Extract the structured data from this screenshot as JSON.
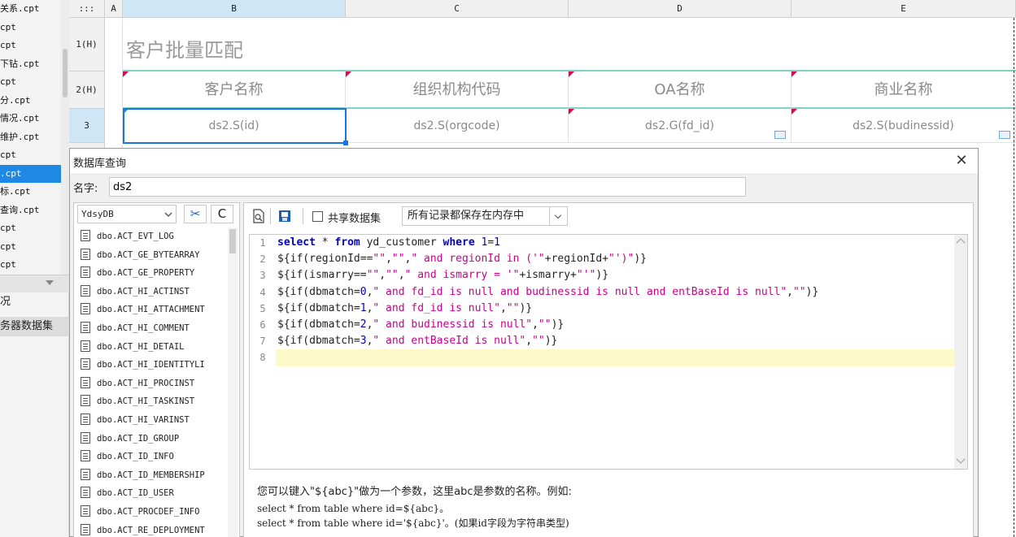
{
  "left_panel": {
    "files": [
      "关系.cpt",
      "cpt",
      "cpt",
      "下钻.cpt",
      "cpt",
      "分.cpt",
      "情况.cpt",
      "维护.cpt",
      "cpt",
      ".cpt",
      "标.cpt",
      "查询.cpt",
      "cpt",
      "cpt",
      "cpt"
    ],
    "selected_index": 9,
    "tree_items": [
      "况",
      "务器数据集"
    ]
  },
  "sheet": {
    "corner_label": ":::",
    "columns": [
      "A",
      "B",
      "C",
      "D",
      "E"
    ],
    "rows": [
      "1(H)",
      "2(H)",
      "3"
    ],
    "title": "客户批量匹配",
    "headers": [
      "客户名称",
      "组织机构代码",
      "OA名称",
      "商业名称"
    ],
    "cells": [
      "ds2.S(id)",
      "ds2.S(orgcode)",
      "ds2.G(fd_id)",
      "ds2.S(budinessid)"
    ]
  },
  "dialog": {
    "title": "数据库查询",
    "close": "✕",
    "name_label": "名字:",
    "name_value": "ds2",
    "database": "YdsyDB",
    "refresh_glyph": "C",
    "tools_glyph": "✂",
    "tables": [
      "dbo.ACT_EVT_LOG",
      "dbo.ACT_GE_BYTEARRAY",
      "dbo.ACT_GE_PROPERTY",
      "dbo.ACT_HI_ACTINST",
      "dbo.ACT_HI_ATTACHMENT",
      "dbo.ACT_HI_COMMENT",
      "dbo.ACT_HI_DETAIL",
      "dbo.ACT_HI_IDENTITYLI",
      "dbo.ACT_HI_PROCINST",
      "dbo.ACT_HI_TASKINST",
      "dbo.ACT_HI_VARINST",
      "dbo.ACT_ID_GROUP",
      "dbo.ACT_ID_INFO",
      "dbo.ACT_ID_MEMBERSHIP",
      "dbo.ACT_ID_USER",
      "dbo.ACT_PROCDEF_INFO",
      "dbo.ACT_RE_DEPLOYMENT"
    ],
    "share_label": "共享数据集",
    "share_checked": false,
    "cache_option": "所有记录都保存在内存中",
    "sql_lines": [
      "select * from yd_customer where 1=1",
      "${if(regionId==\"\",\"\",\" and regionId in ('\"+regionId+\"')\")}",
      "${if(ismarry==\"\",\"\",\" and ismarry = '\"+ismarry+\"'\")}",
      "${if(dbmatch=0,\" and fd_id is null and budinessid is null and entBaseId is null\",\"\")}",
      "${if(dbmatch=1,\" and fd_id is null\",\"\")}",
      "${if(dbmatch=2,\" and budinessid is null\",\"\")}",
      "${if(dbmatch=3,\" and entBaseId is null\",\"\")}",
      ""
    ],
    "help_text": "您可以键入\"${abc}\"做为一个参数，这里abc是参数的名称。例如:",
    "help_example_1": "select * from table where id=${abc}。",
    "help_example_2": "select * from table where id='${abc}'。(如果id字段为字符串类型)"
  }
}
